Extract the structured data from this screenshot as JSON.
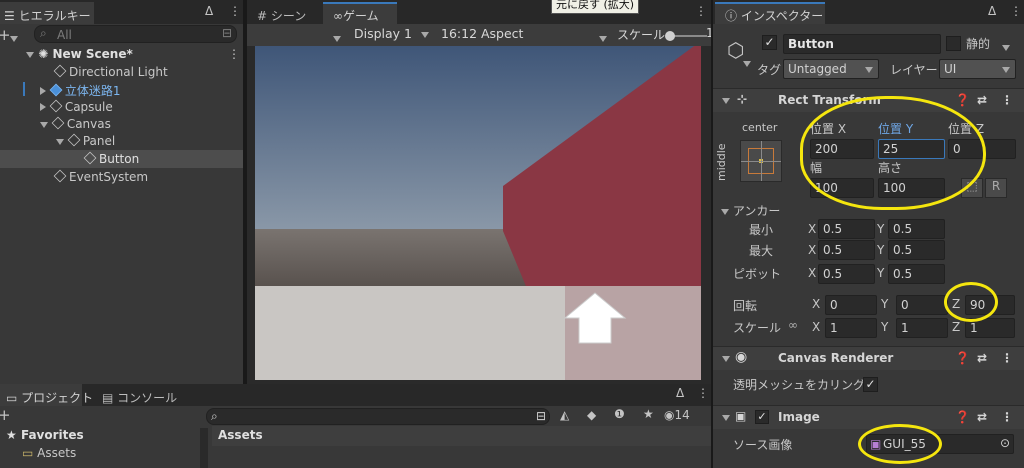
{
  "tooltip": "元に戻す (拡大)",
  "hierarchy": {
    "tab": "ヒエラルキー",
    "search_placeholder": "All",
    "items": [
      "New Scene*",
      "Directional Light",
      "立体迷路1",
      "Capsule",
      "Canvas",
      "Panel",
      "Button",
      "EventSystem"
    ]
  },
  "game": {
    "tabs": [
      "シーン",
      "ゲーム"
    ],
    "display": "Display 1",
    "aspect": "16:12 Aspect",
    "scale_label": "スケール",
    "scale_value": "1"
  },
  "project": {
    "tabs": [
      "プロジェクト",
      "コンソール"
    ],
    "favorites": "Favorites",
    "assets_tree": "Assets",
    "assets_header": "Assets",
    "count": "14"
  },
  "inspector": {
    "tab": "インスペクター",
    "name": "Button",
    "static": "静的",
    "tag_label": "タグ",
    "tag": "Untagged",
    "layer_label": "レイヤー",
    "layer": "UI",
    "rect": {
      "title": "Rect Transform",
      "h_align": "center",
      "v_align": "middle",
      "pos_x_label": "位置 X",
      "pos_y_label": "位置 Y",
      "pos_z_label": "位置 Z",
      "pos_x": "200",
      "pos_y": "25",
      "pos_z": "0",
      "width_label": "幅",
      "height_label": "高さ",
      "width": "100",
      "height": "100",
      "r_label": "R",
      "anchor_label": "アンカー",
      "min_label": "最小",
      "max_label": "最大",
      "min_x": "0.5",
      "min_y": "0.5",
      "max_x": "0.5",
      "max_y": "0.5",
      "pivot_label": "ピボット",
      "pivot_x": "0.5",
      "pivot_y": "0.5",
      "rotation_label": "回転",
      "rot_x": "0",
      "rot_y": "0",
      "rot_z": "90",
      "scale_label": "スケール",
      "scale_x": "1",
      "scale_y": "1",
      "scale_z": "1",
      "x": "X",
      "y": "Y",
      "z": "Z"
    },
    "canvas_renderer": {
      "title": "Canvas Renderer",
      "cull_label": "透明メッシュをカリング"
    },
    "image": {
      "title": "Image",
      "source_label": "ソース画像",
      "source": "GUI_55"
    }
  },
  "colors": {
    "accent": "#3a79bb",
    "highlight": "#f5e60e",
    "wall": "#8a3744",
    "sky": "#4a6384"
  }
}
